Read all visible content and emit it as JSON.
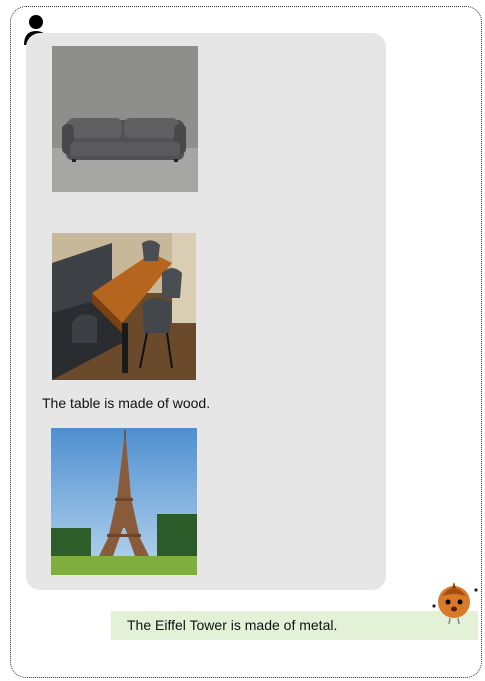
{
  "conversation": {
    "user_message": {
      "images": [
        {
          "icon": "sofa-photo"
        },
        {
          "icon": "dining-table-photo"
        },
        {
          "icon": "eiffel-tower-photo"
        }
      ],
      "caption": "The table is made of wood."
    },
    "bot_message": {
      "text": "The Eiffel Tower is made of metal."
    }
  },
  "colors": {
    "user_bubble": "#e6e6e6",
    "bot_bubble": "#e3f2d7",
    "border": "#333333"
  }
}
